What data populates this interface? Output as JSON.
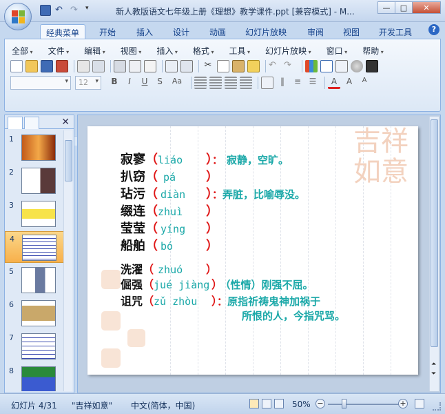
{
  "window": {
    "title": "新人教版语文七年级上册《理想》教学课件.ppt [兼容模式] - M...",
    "minimize": "—",
    "maximize": "□",
    "close": "✕"
  },
  "ribbon_tabs": [
    "经典菜单",
    "开始",
    "插入",
    "设计",
    "动画",
    "幻灯片放映",
    "审阅",
    "视图",
    "开发工具"
  ],
  "help_label": "?",
  "classic_menu": [
    "全部",
    "文件",
    "编辑",
    "视图",
    "插入",
    "格式",
    "工具",
    "幻灯片放映",
    "窗口",
    "帮助"
  ],
  "toolbar": {
    "font_name": "",
    "font_size": "12",
    "format_buttons": [
      "B",
      "I",
      "U",
      "S",
      "Aa"
    ]
  },
  "thumbnails": [
    "1",
    "2",
    "3",
    "4",
    "5",
    "6",
    "7",
    "8"
  ],
  "selected_thumbnail": 4,
  "slide": {
    "rows": [
      {
        "word": "寂寥",
        "pinyin": "liáo",
        "definition": "寂静，空旷。"
      },
      {
        "word": "扒窃",
        "pinyin": "pá",
        "definition": ""
      },
      {
        "word": "玷污",
        "pinyin": "diàn",
        "definition": "弄脏，比喻辱没。"
      },
      {
        "word": "缀连",
        "pinyin": "zhuì",
        "definition": ""
      },
      {
        "word": "莹莹",
        "pinyin": "yíng",
        "definition": ""
      },
      {
        "word": "船舶",
        "pinyin": "bó",
        "definition": ""
      },
      {
        "word": "洗濯",
        "pinyin": "zhuó",
        "definition": ""
      },
      {
        "word": "倔强",
        "pinyin": "jué jiàng",
        "definition": "（性情）刚强不屈。"
      },
      {
        "word": "诅咒",
        "pinyin": "zǔ zhòu",
        "definition": "原指祈祷鬼神加祸于",
        "definition2": "所恨的人，今指咒骂。"
      }
    ],
    "stamp_text": "吉祥如意"
  },
  "status": {
    "slide_indicator": "幻灯片 4/31",
    "theme": "\"吉祥如意\"",
    "language": "中文(简体，中国)",
    "zoom": "50%"
  },
  "colors": {
    "accent_red": "#e01818",
    "accent_teal": "#1aa8a8",
    "ribbon_blue": "#c5d8ef",
    "selected_orange": "#f7b04b"
  }
}
